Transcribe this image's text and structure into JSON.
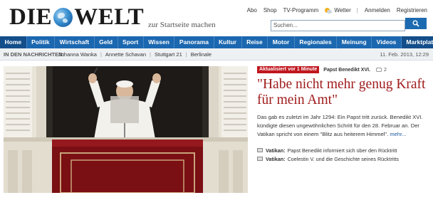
{
  "logo": {
    "word1": "DIE",
    "word2": "WELT"
  },
  "startseite_label": "zur Startseite machen",
  "toplinks": [
    "Abo",
    "Shop",
    "TV-Programm"
  ],
  "wetter_label": "Wetter",
  "account_links": [
    "Anmelden",
    "Registrieren"
  ],
  "search": {
    "placeholder": "Suchen...",
    "value": "Suchen..."
  },
  "nav": {
    "items": [
      "Home",
      "Politik",
      "Wirtschaft",
      "Geld",
      "Sport",
      "Wissen",
      "Panorama",
      "Kultur",
      "Reise",
      "Motor",
      "Regionales",
      "Meinung",
      "Videos"
    ],
    "last": "Marktplatz"
  },
  "ticker": {
    "label": "IN DEN NACHRICHTEN:",
    "tags": [
      "Johanna Wanka",
      "Annette Schavan",
      "Stuttgart 21",
      "Berlinale"
    ],
    "date": "11. Feb. 2013, 12:29"
  },
  "article": {
    "badge": "Aktualisiert vor 1 Minute",
    "kicker": "Papst Benedikt XVI.",
    "comments": "2",
    "headline": "\"Habe nicht mehr genug Kraft für mein Amt\"",
    "teaser": "Das gab es zuletzt im Jahr 1294: Ein Papst tritt zurück. Benedikt XVI. kündigte diesen ungewöhnlichen Schritt für den 28. Februar an. Der Vatikan spricht von einem \"Blitz aus heiterem Himmel\".",
    "more": "mehr...",
    "related": [
      {
        "prefix": "Vatikan:",
        "text": "Papst Benedikt informiert sich über den Rücktritt"
      },
      {
        "prefix": "Vatikan:",
        "text": "Coelestin V. und die Geschichte seines Rücktritts"
      }
    ]
  },
  "colors": {
    "nav_blue": "#1b67b0",
    "headline_red": "#a01c1c",
    "badge_red": "#c0161e"
  }
}
